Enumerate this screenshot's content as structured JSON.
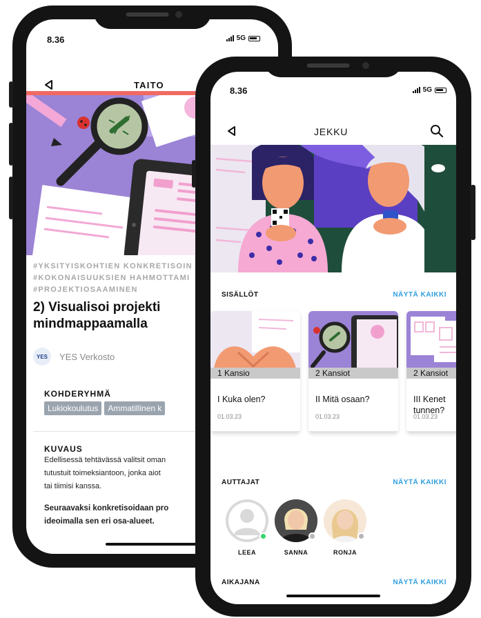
{
  "colors": {
    "accent_red": "#f06a63",
    "link_blue": "#2f9fde",
    "chip_gray": "#9aa4ae",
    "status_online": "#3ad36c",
    "status_offline": "#b7b7b7",
    "hero_purple": "#9b83d6"
  },
  "back_phone": {
    "status": {
      "time": "8.36",
      "network": "5G"
    },
    "header": {
      "title": "TAITO",
      "back_icon": "back-arrow-icon"
    },
    "tags": [
      "#YKSITYISKOHTIEN KONKRETISOIN",
      "#KOKONAISUUKSIEN HAHMOTTAMI",
      "#PROJEKTIOSAAMINEN"
    ],
    "title_lines": [
      "2) Visualisoi projekti",
      "mindmappaamalla"
    ],
    "author": {
      "logo_text": "YES",
      "name": "YES Verkosto"
    },
    "target_group": {
      "label": "KOHDERYHMÄ",
      "chips": [
        "Lukiokoulutus",
        "Ammatillinen k"
      ]
    },
    "description": {
      "label": "KUVAUS",
      "lines": [
        "Edellisessä tehtävässä valitsit oman",
        "tutustuit toimeksiantoon, jonka aiot",
        "tai tiimisi kanssa."
      ],
      "bold_lines": [
        "Seuraavaksi konkretisoidaan pro",
        "ideoimalla sen eri osa-alueet."
      ]
    }
  },
  "front_phone": {
    "status": {
      "time": "8.36",
      "network": "5G"
    },
    "header": {
      "title": "JEKKU",
      "back_icon": "back-arrow-icon",
      "search_icon": "search-icon"
    },
    "contents": {
      "label": "SISÄLLÖT",
      "link": "NÄYTÄ KAIKKI",
      "cards": [
        {
          "band": "1 Kansio",
          "title_lines": [
            "I Kuka olen?"
          ],
          "date": "01.03.23"
        },
        {
          "band": "2 Kansiot",
          "title_lines": [
            "II Mitä osaan?"
          ],
          "date": "01.03.23"
        },
        {
          "band": "2 Kansiot",
          "title_lines": [
            "III Kenet",
            "tunnen?"
          ],
          "date": "01.03.23"
        }
      ]
    },
    "helpers": {
      "label": "AUTTAJAT",
      "link": "NÄYTÄ KAIKKI",
      "people": [
        {
          "name": "LEEA",
          "status": "online"
        },
        {
          "name": "SANNA",
          "status": "offline"
        },
        {
          "name": "RONJA",
          "status": "offline"
        }
      ]
    },
    "timeline": {
      "label": "AIKAJANA",
      "link": "NÄYTÄ KAIKKI"
    }
  }
}
